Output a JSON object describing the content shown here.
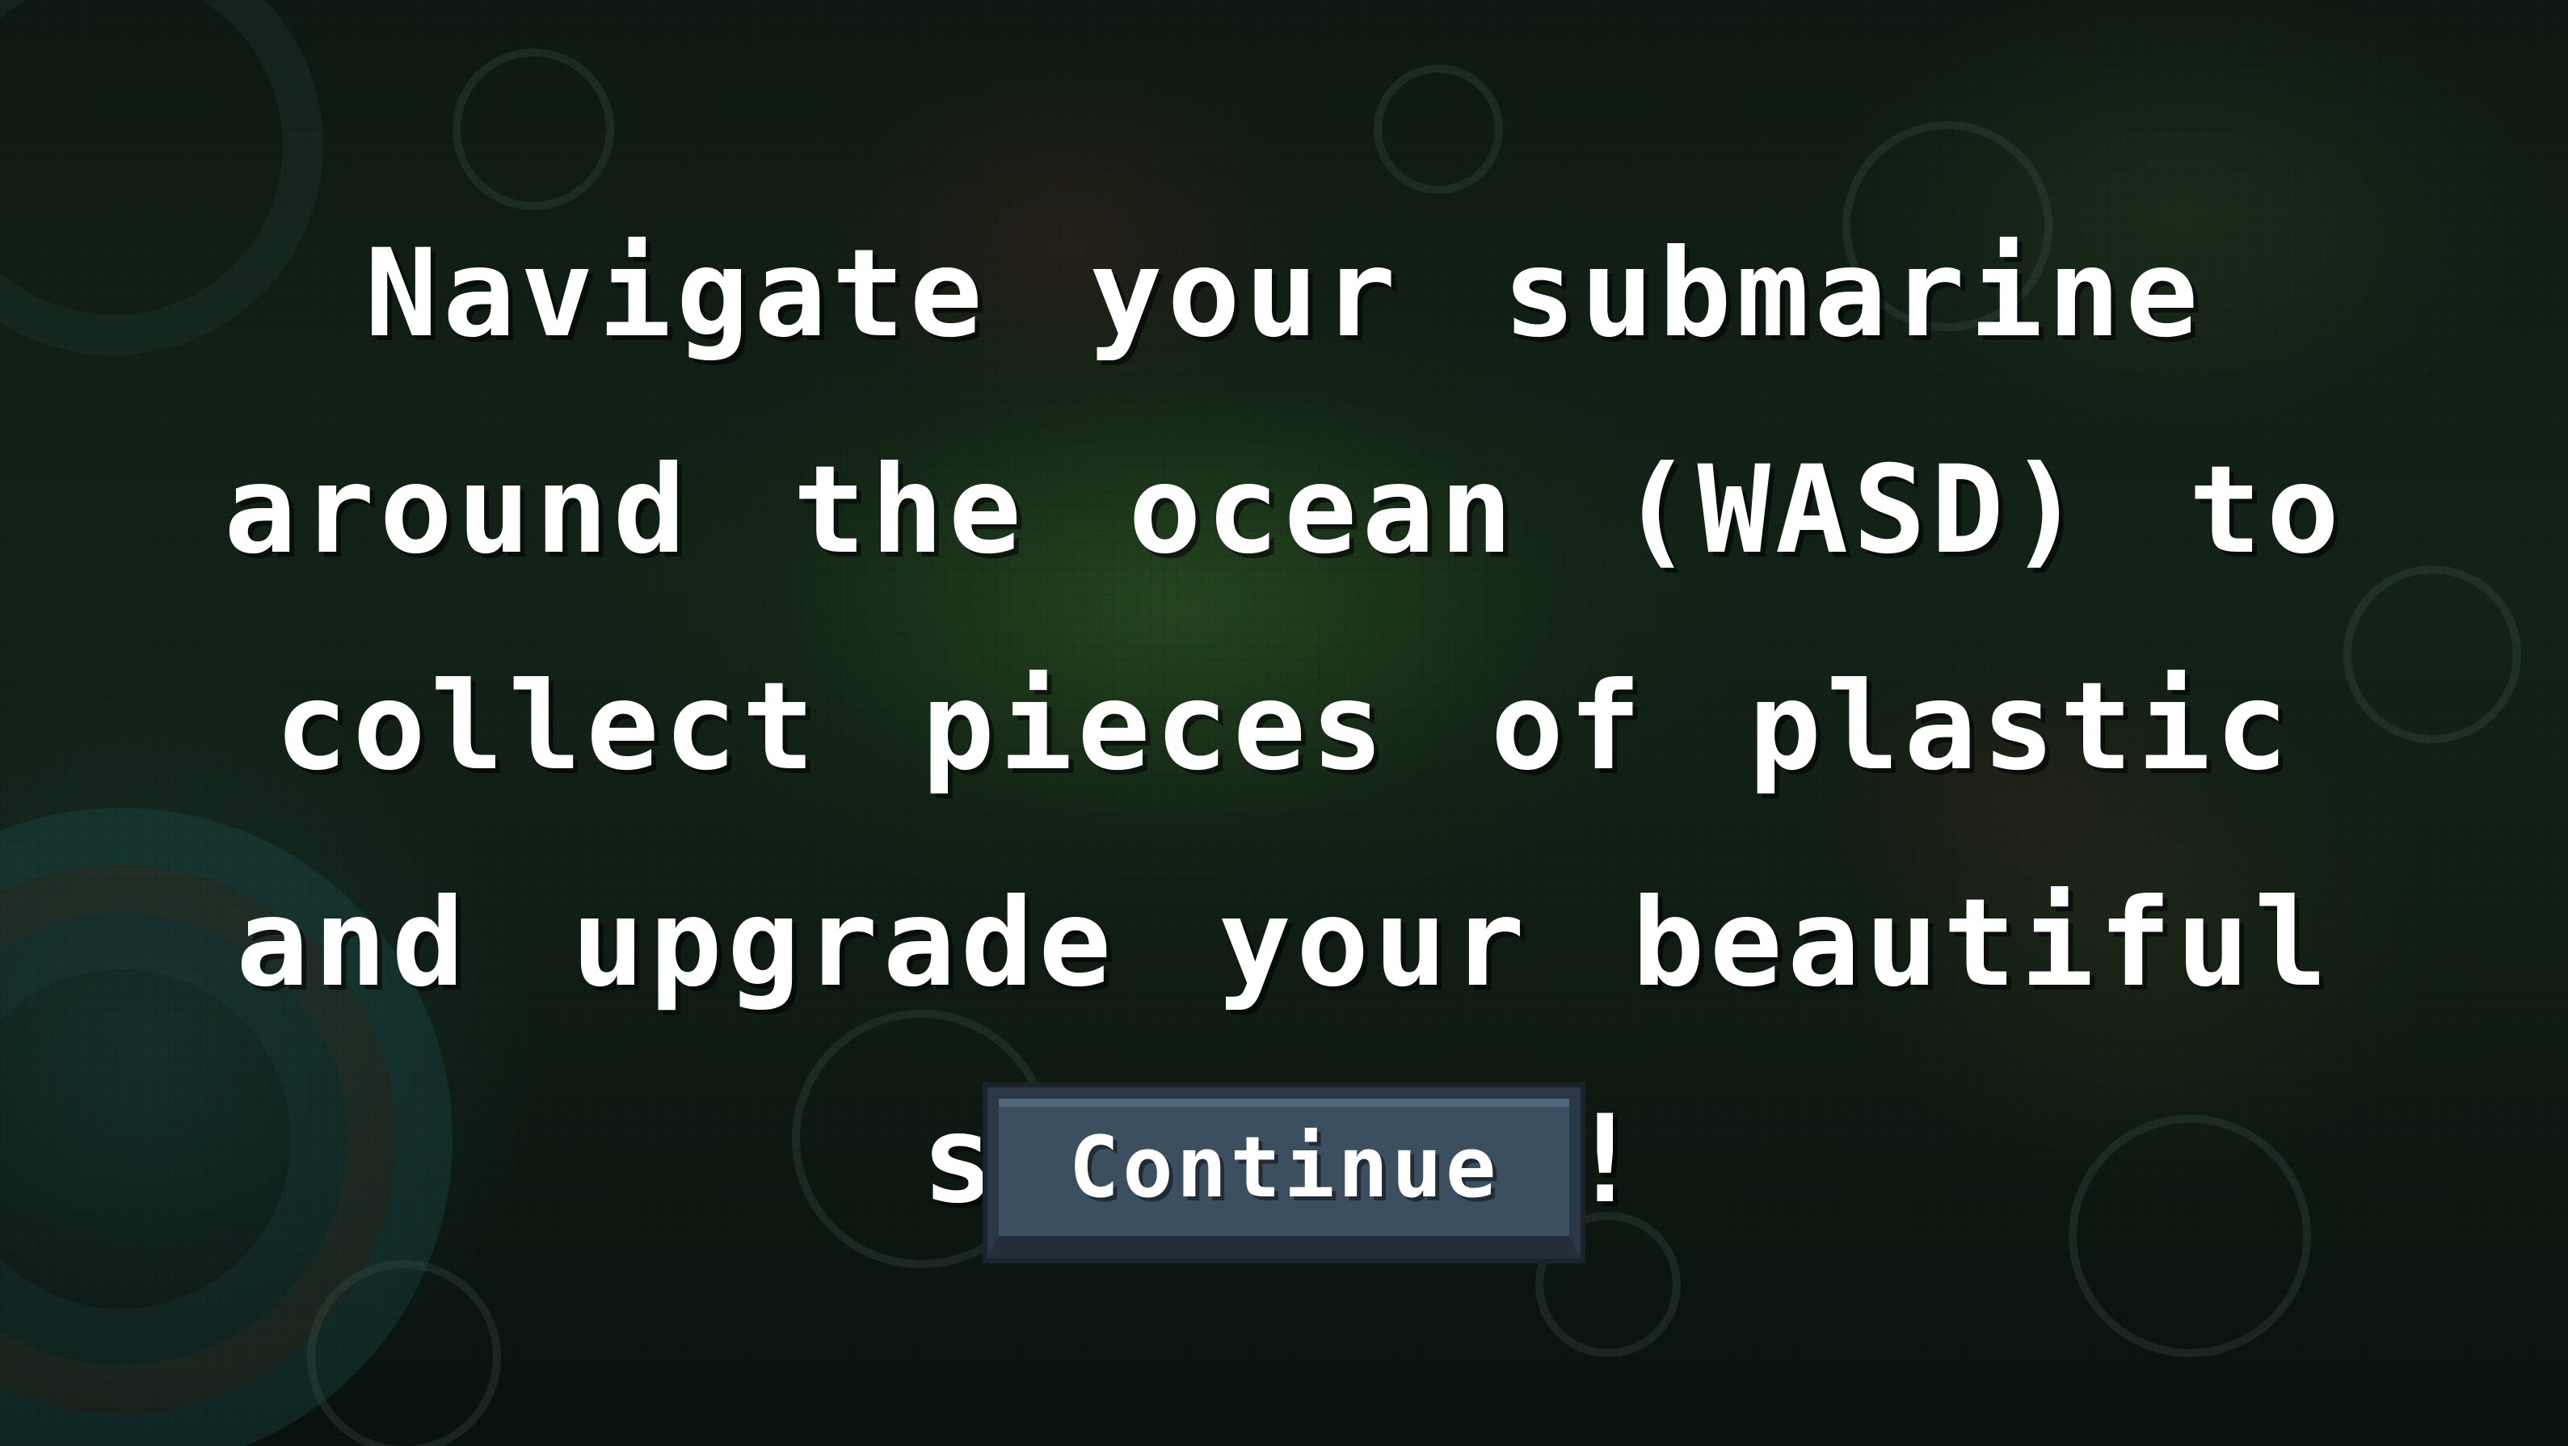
{
  "dialog": {
    "instruction": "Navigate your submarine around the ocean (WASD) to collect pieces of plastic and upgrade your beautiful ship (E)!",
    "continue_label": "Continue"
  },
  "background": {
    "scene": "pixel-art-underwater-ocean"
  },
  "colors": {
    "text": "#ffffff",
    "button_fill": "#3c4f60",
    "button_border": "#2a3744"
  }
}
